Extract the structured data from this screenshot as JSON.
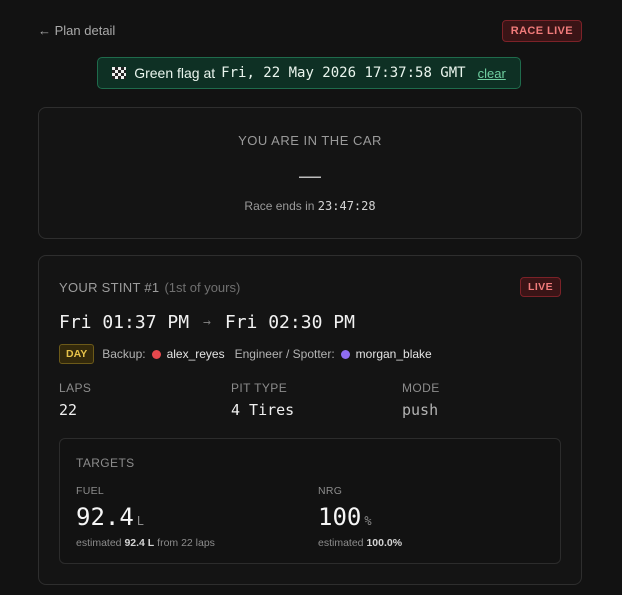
{
  "header": {
    "back_label": "← Plan detail",
    "race_live_label": "RACE LIVE"
  },
  "banner": {
    "prefix": "Green flag at",
    "time": "Fri, 22 May 2026 17:37:58 GMT",
    "clear_label": "clear"
  },
  "car": {
    "status": "YOU ARE IN THE CAR",
    "driver": "—",
    "ends_label": "Race ends in",
    "countdown": "23:47:28"
  },
  "stint": {
    "title": "YOUR STINT #1",
    "subtitle": "(1st of yours)",
    "live_label": "LIVE",
    "start": "Fri 01:37 PM",
    "arrow": "→",
    "end": "Fri 02:30 PM",
    "day_label": "DAY",
    "backup_label": "Backup:",
    "backup_name": "alex_reyes",
    "backup_color": "#e5484d",
    "spotter_label": "Engineer / Spotter:",
    "spotter_name": "morgan_blake",
    "spotter_color": "#8e6cf0",
    "laps_label": "LAPS",
    "laps_value": "22",
    "pit_label": "PIT TYPE",
    "pit_value": "4 Tires",
    "mode_label": "MODE",
    "mode_value": "push"
  },
  "targets": {
    "title": "TARGETS",
    "fuel": {
      "label": "FUEL",
      "value": "92.4",
      "unit": "L",
      "est_prefix": "estimated",
      "est_value": "92.4 L",
      "est_suffix": "from 22 laps"
    },
    "nrg": {
      "label": "NRG",
      "value": "100",
      "unit": "%",
      "est_prefix": "estimated",
      "est_value": "100.0%",
      "est_suffix": ""
    }
  },
  "colors": {
    "accent_green": "#6fcfa0",
    "live_red": "#f07b7b",
    "day_yellow": "#e6c24a"
  }
}
